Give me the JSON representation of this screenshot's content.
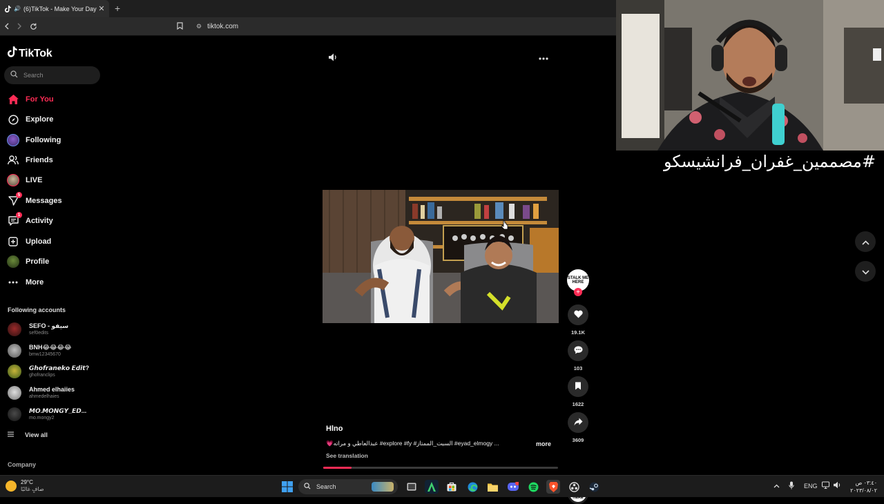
{
  "browser": {
    "tab_title": "(6)TikTok - Make Your Day",
    "tab_close": "✕",
    "new_tab": "+",
    "url": "tiktok.com"
  },
  "sidebar": {
    "logo": "TikTok",
    "search_placeholder": "Search",
    "nav": [
      {
        "label": "For You",
        "icon": "home-icon",
        "active": true
      },
      {
        "label": "Explore",
        "icon": "compass-icon"
      },
      {
        "label": "Following",
        "icon": "following-avatar-icon"
      },
      {
        "label": "Friends",
        "icon": "friends-icon"
      },
      {
        "label": "LIVE",
        "icon": "live-icon"
      },
      {
        "label": "Messages",
        "icon": "messages-icon",
        "badge": "5"
      },
      {
        "label": "Activity",
        "icon": "activity-icon",
        "badge": "1"
      },
      {
        "label": "Upload",
        "icon": "upload-icon"
      },
      {
        "label": "Profile",
        "icon": "profile-icon"
      },
      {
        "label": "More",
        "icon": "more-icon"
      }
    ],
    "following_title": "Following accounts",
    "accounts": [
      {
        "name": "SEFO - سيفو",
        "handle": "sef0edits"
      },
      {
        "name": "BNH😂😂😂😂",
        "handle": "bmw12345670"
      },
      {
        "name": "𝙂𝙝𝙤𝙛𝙧𝙖𝙣𝙚𝙠𝙤 𝙀𝙙𝙞𝙩?",
        "handle": "ghofranclips"
      },
      {
        "name": "Ahmed elhaiies",
        "handle": "ahmedelhaies"
      },
      {
        "name": "𝙈𝙊.𝙈𝙊𝙉𝙂𝙔_𝙀𝘿...",
        "handle": "mo.mongy2"
      }
    ],
    "view_all": "View all",
    "company": "Company"
  },
  "video": {
    "username": "Hlno",
    "caption": "💗عبدالعاطي و مراته #explore #fy #السبت_الممتاز #eyad_elmogy ...",
    "more": "more",
    "see_translation": "See translation",
    "progress": 0.12,
    "likes": "19.1K",
    "comments": "103",
    "saves": "1622",
    "shares": "3609",
    "creator_avatar_text": "STALK ME HERE"
  },
  "overlay": {
    "hashtag": "مصممين_غفران_فرانشيسكو#"
  },
  "taskbar": {
    "temp": "29°C",
    "condition": "صافٍ غالبًا",
    "search": "Search",
    "lang": "ENG",
    "time": "٠٣:٤٠ ص",
    "date": "٢٠٢٣/٠٨/٠٢"
  }
}
